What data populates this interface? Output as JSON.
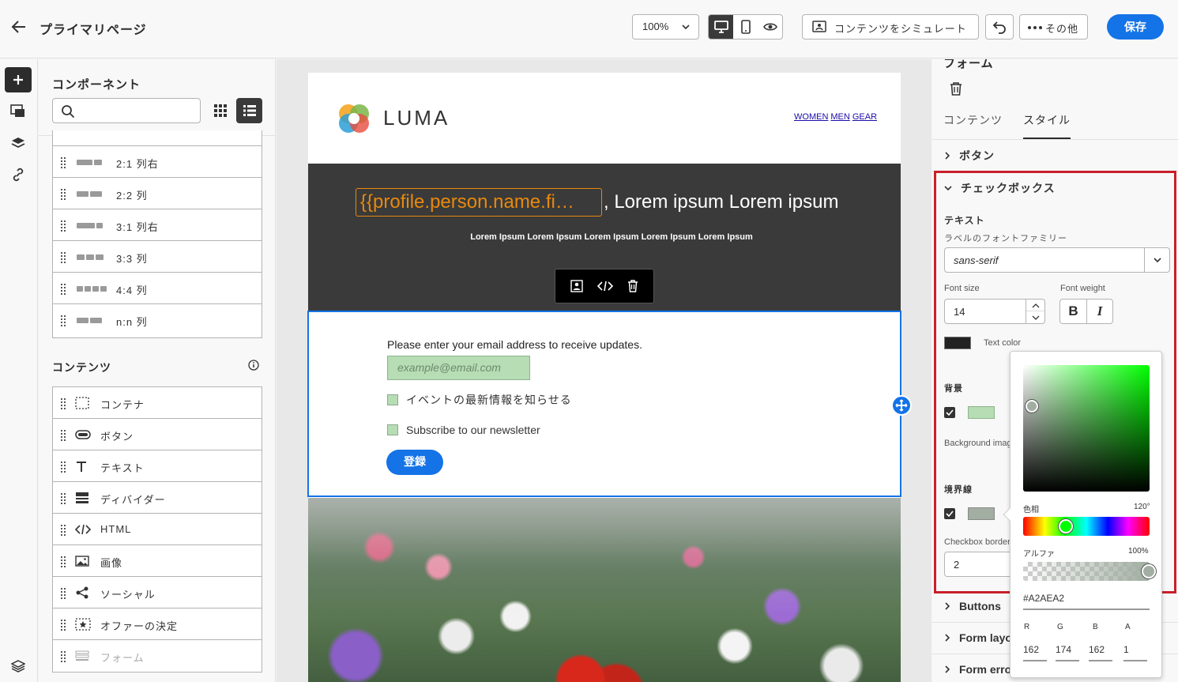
{
  "topbar": {
    "title": "プライマリページ",
    "zoom": "100%",
    "simulate_label": "コンテンツをシミュレート",
    "more_label": "その他",
    "save_label": "保存"
  },
  "components": {
    "title": "コンポーネント",
    "search_placeholder": "",
    "structures": [
      {
        "label": "2:1 列右",
        "cols": [
          2,
          1
        ]
      },
      {
        "label": "2:2 列",
        "cols": [
          1,
          1
        ]
      },
      {
        "label": "3:1 列右",
        "cols": [
          3,
          1
        ]
      },
      {
        "label": "3:3 列",
        "cols": [
          1,
          1,
          1
        ]
      },
      {
        "label": "4:4 列",
        "cols": [
          1,
          1,
          1,
          1
        ]
      },
      {
        "label": "n:n 列",
        "cols": [
          1,
          1
        ]
      }
    ],
    "content_title": "コンテンツ",
    "content_items": [
      {
        "label": "コンテナ",
        "icon": "container-icon"
      },
      {
        "label": "ボタン",
        "icon": "button-icon"
      },
      {
        "label": "テキスト",
        "icon": "text-icon"
      },
      {
        "label": "ディバイダー",
        "icon": "divider-icon"
      },
      {
        "label": "HTML",
        "icon": "code-icon"
      },
      {
        "label": "画像",
        "icon": "image-icon"
      },
      {
        "label": "ソーシャル",
        "icon": "share-icon"
      },
      {
        "label": "オファーの決定",
        "icon": "offer-icon"
      },
      {
        "label": "フォーム",
        "icon": "form-icon"
      }
    ]
  },
  "email": {
    "brand": "LUMA",
    "nav": [
      "WOMEN",
      "MEN",
      "GEAR"
    ],
    "token": "{{profile.person.name.fi…",
    "hero_title": ", Lorem ipsum Lorem ipsum",
    "hero_sub": "Lorem Ipsum Lorem Ipsum Lorem Ipsum  Lorem Ipsum  Lorem Ipsum",
    "form_intro": "Please enter your email address to receive updates.",
    "email_placeholder": "example@email.com",
    "checkbox_1": "イベントの最新情報を知らせる",
    "checkbox_2": "Subscribe to our newsletter",
    "submit_label": "登録"
  },
  "inspector": {
    "title": "フォーム",
    "tabs": [
      "コンテンツ",
      "スタイル"
    ],
    "active_tab": "スタイル",
    "sections": {
      "button": "ボタン",
      "checkbox": "チェックボックス",
      "buttons": "Buttons",
      "form_layout": "Form layou",
      "form_error": "Form error"
    },
    "text_label": "テキスト",
    "font_family_label": "ラベルのフォントファミリー",
    "font_family_value": "sans-serif",
    "font_size_label": "Font size",
    "font_size_value": "14",
    "font_weight_label": "Font weight",
    "bold_label": "B",
    "italic_label": "I",
    "text_color_label": "Text color",
    "text_color": "#222222",
    "bg_label": "背景",
    "bg_color": "#b6ddb4",
    "bg_image_label": "Background imag",
    "border_label": "境界線",
    "border_color": "#a2aea2",
    "border_width_label": "Checkbox border",
    "border_width_value": "2"
  },
  "color_picker": {
    "hue_label": "色相",
    "hue_value": "120°",
    "alpha_label": "アルファ",
    "alpha_value": "100%",
    "hex": "#A2AEA2",
    "r_label": "R",
    "g_label": "G",
    "b_label": "B",
    "a_label": "A",
    "r": "162",
    "g": "174",
    "b": "162",
    "a": "1"
  }
}
